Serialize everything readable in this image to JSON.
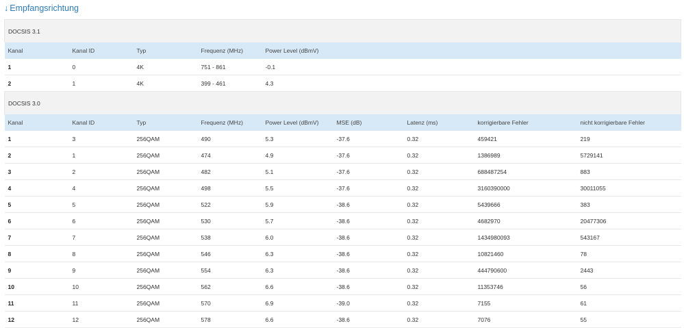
{
  "page": {
    "arrow": "↓",
    "title": "Empfangsrichtung"
  },
  "docsis31": {
    "group_label": "DOCSIS 3.1",
    "headers": [
      "Kanal",
      "Kanal ID",
      "Typ",
      "Frequenz (MHz)",
      "Power Level (dBmV)"
    ],
    "rows": [
      [
        "1",
        "0",
        "4K",
        "751 - 861",
        "-0.1"
      ],
      [
        "2",
        "1",
        "4K",
        "399 - 461",
        "4.3"
      ]
    ]
  },
  "docsis30": {
    "group_label": "DOCSIS 3.0",
    "headers": [
      "Kanal",
      "Kanal ID",
      "Typ",
      "Frequenz (MHz)",
      "Power Level (dBmV)",
      "MSE (dB)",
      "Latenz (ms)",
      "korrigierbare Fehler",
      "nicht korrigierbare Fehler"
    ],
    "rows": [
      [
        "1",
        "3",
        "256QAM",
        "490",
        "5.3",
        "-37.6",
        "0.32",
        "459421",
        "219"
      ],
      [
        "2",
        "1",
        "256QAM",
        "474",
        "4.9",
        "-37.6",
        "0.32",
        "1386989",
        "5729141"
      ],
      [
        "3",
        "2",
        "256QAM",
        "482",
        "5.1",
        "-37.6",
        "0.32",
        "688487254",
        "883"
      ],
      [
        "4",
        "4",
        "256QAM",
        "498",
        "5.5",
        "-37.6",
        "0.32",
        "3160390000",
        "30011055"
      ],
      [
        "5",
        "5",
        "256QAM",
        "522",
        "5.9",
        "-38.6",
        "0.32",
        "5439666",
        "383"
      ],
      [
        "6",
        "6",
        "256QAM",
        "530",
        "5.7",
        "-38.6",
        "0.32",
        "4682970",
        "20477306"
      ],
      [
        "7",
        "7",
        "256QAM",
        "538",
        "6.0",
        "-38.6",
        "0.32",
        "1434980093",
        "543167"
      ],
      [
        "8",
        "8",
        "256QAM",
        "546",
        "6.3",
        "-38.6",
        "0.32",
        "10821460",
        "78"
      ],
      [
        "9",
        "9",
        "256QAM",
        "554",
        "6.3",
        "-38.6",
        "0.32",
        "444790600",
        "2443"
      ],
      [
        "10",
        "10",
        "256QAM",
        "562",
        "6.6",
        "-38.6",
        "0.32",
        "11353746",
        "56"
      ],
      [
        "11",
        "11",
        "256QAM",
        "570",
        "6.9",
        "-39.0",
        "0.32",
        "7155",
        "61"
      ],
      [
        "12",
        "12",
        "256QAM",
        "578",
        "6.6",
        "-38.6",
        "0.32",
        "7076",
        "55"
      ]
    ]
  }
}
